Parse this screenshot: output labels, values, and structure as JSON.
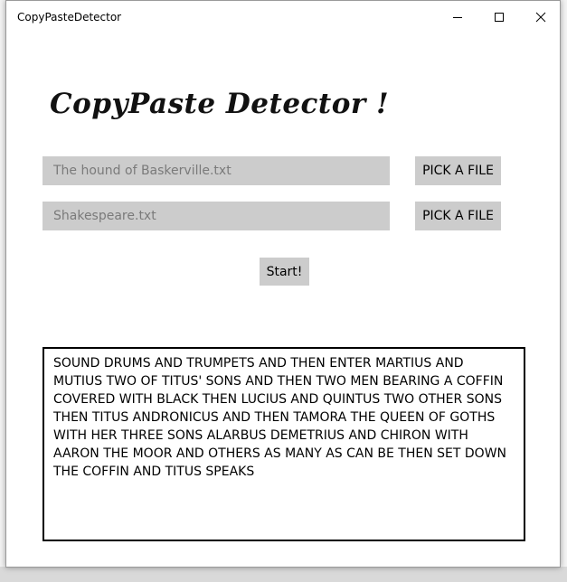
{
  "window": {
    "title": "CopyPasteDetector"
  },
  "app": {
    "logo_text": "CopyPaste Detector !"
  },
  "inputs": {
    "file1_placeholder": "The hound of Baskerville.txt",
    "file2_placeholder": "Shakespeare.txt"
  },
  "buttons": {
    "pick_file_1": "PICK A FILE",
    "pick_file_2": "PICK A FILE",
    "start": "Start!"
  },
  "output": {
    "text": "SOUND DRUMS AND TRUMPETS AND THEN ENTER MARTIUS AND MUTIUS TWO OF TITUS' SONS AND THEN TWO MEN BEARING A COFFIN COVERED WITH BLACK THEN LUCIUS AND QUINTUS TWO OTHER SONS THEN TITUS ANDRONICUS AND THEN TAMORA THE QUEEN OF GOTHS WITH HER THREE SONS ALARBUS DEMETRIUS AND CHIRON WITH AARON THE MOOR AND OTHERS AS MANY AS CAN BE THEN SET DOWN THE COFFIN AND TITUS SPEAKS"
  }
}
